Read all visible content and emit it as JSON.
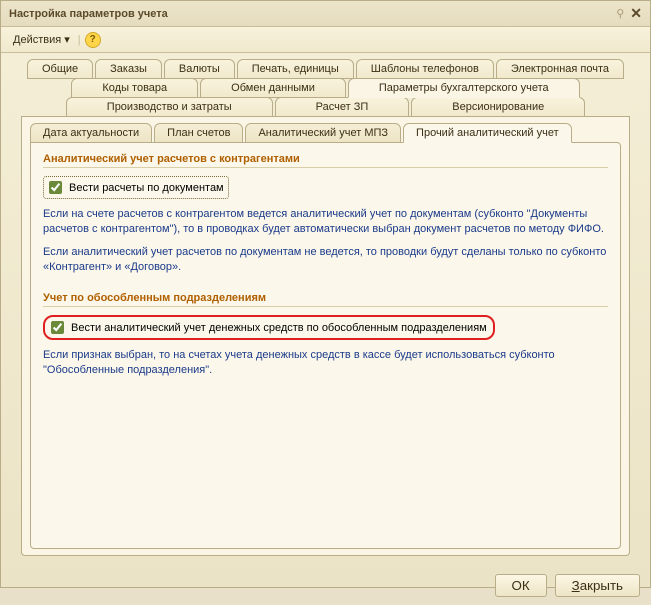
{
  "window": {
    "title": "Настройка параметров учета"
  },
  "toolbar": {
    "actions_label": "Действия ▾"
  },
  "tabs_row1": [
    {
      "label": "Общие"
    },
    {
      "label": "Заказы"
    },
    {
      "label": "Валюты"
    },
    {
      "label": "Печать, единицы"
    },
    {
      "label": "Шаблоны телефонов"
    },
    {
      "label": "Электронная почта"
    }
  ],
  "tabs_row2": [
    {
      "label": "Коды товара"
    },
    {
      "label": "Обмен данными"
    },
    {
      "label": "Параметры бухгалтерского учета"
    }
  ],
  "tabs_row3": [
    {
      "label": "Производство и затраты"
    },
    {
      "label": "Расчет ЗП"
    },
    {
      "label": "Версионирование"
    }
  ],
  "inner_tabs": [
    {
      "label": "Дата актуальности"
    },
    {
      "label": "План счетов"
    },
    {
      "label": "Аналитический учет МПЗ"
    },
    {
      "label": "Прочий аналитический учет"
    }
  ],
  "section1": {
    "title": "Аналитический учет расчетов с контрагентами",
    "checkbox_label": "Вести расчеты по документам",
    "info1": "Если на счете расчетов с контрагентом ведется аналитический учет по документам (субконто \"Документы расчетов с контрагентом\"), то в проводках будет автоматически выбран документ расчетов по методу ФИФО.",
    "info2": "Если аналитический учет расчетов по документам не ведется, то проводки будут сделаны только по субконто «Контрагент» и «Договор»."
  },
  "section2": {
    "title": "Учет по обособленным подразделениям",
    "checkbox_label": "Вести аналитический учет денежных средств по обособленным подразделениям",
    "info": "Если признак выбран, то на счетах учета денежных средств в кассе будет использоваться субконто \"Обособленные подразделения\"."
  },
  "footer": {
    "ok": "ОК",
    "close_prefix": "З",
    "close_rest": "акрыть"
  }
}
